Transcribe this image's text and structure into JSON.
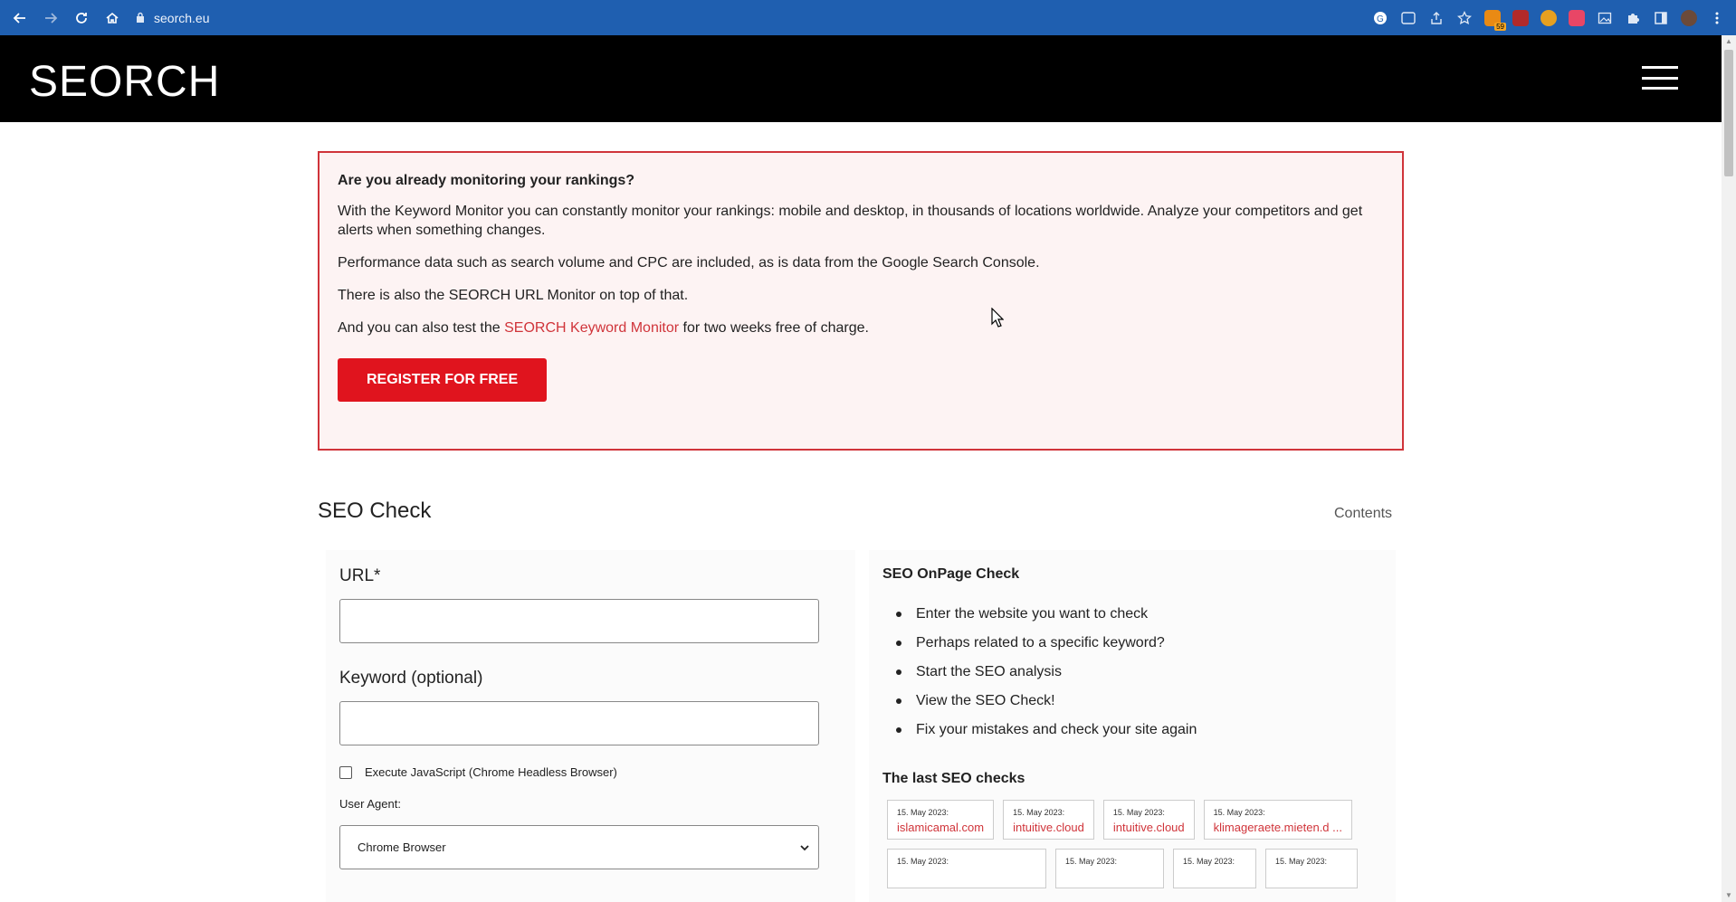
{
  "browser": {
    "url": "seorch.eu",
    "ext_badge": "59"
  },
  "site": {
    "logo": "SEORCH"
  },
  "promo": {
    "heading": "Are you already monitoring your rankings?",
    "p1": "With the Keyword Monitor you can constantly monitor your rankings: mobile and desktop, in thousands of locations worldwide. Analyze your competitors and get alerts when something changes.",
    "p2": "Performance data such as search volume and CPC are included, as is data from the Google Search Console.",
    "p3": "There is also the SEORCH URL Monitor on top of that.",
    "p4_before": "And you can also test the ",
    "p4_link": "SEORCH Keyword Monitor",
    "p4_after": " for two weeks free of charge.",
    "button": "REGISTER FOR FREE"
  },
  "seo": {
    "title": "SEO Check",
    "contents": "Contents",
    "form": {
      "url_label": "URL*",
      "keyword_label": "Keyword (optional)",
      "js_label": "Execute JavaScript (Chrome Headless Browser)",
      "ua_label": "User Agent:",
      "ua_value": "Chrome Browser"
    },
    "info": {
      "heading": "SEO OnPage Check",
      "steps": [
        "Enter the website you want to check",
        "Perhaps related to a specific keyword?",
        "Start the SEO analysis",
        "View the SEO Check!",
        "Fix your mistakes and check your site again"
      ],
      "last_heading": "The last SEO checks",
      "checks": [
        {
          "date": "15. May 2023:",
          "host": "islamicamal.com"
        },
        {
          "date": "15. May 2023:",
          "host": "intuitive.cloud"
        },
        {
          "date": "15. May 2023:",
          "host": "intuitive.cloud"
        },
        {
          "date": "15. May 2023:",
          "host": "klimageraete.mieten.d ..."
        },
        {
          "date": "15. May 2023:",
          "host": ""
        },
        {
          "date": "15. May 2023:",
          "host": ""
        },
        {
          "date": "15. May 2023:",
          "host": ""
        },
        {
          "date": "15. May 2023:",
          "host": ""
        }
      ]
    }
  }
}
